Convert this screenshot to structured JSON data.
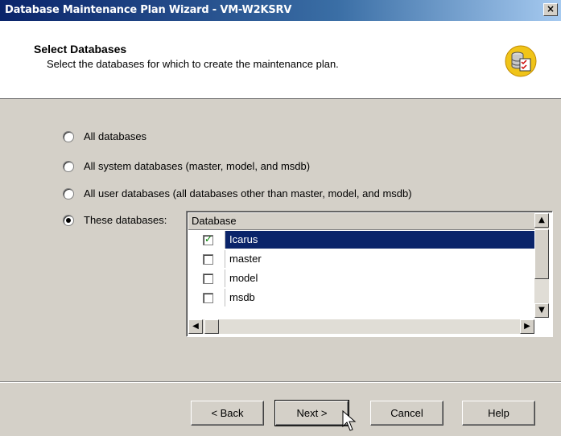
{
  "window": {
    "title": "Database Maintenance Plan Wizard - VM-W2KSRV",
    "close_label": "×"
  },
  "header": {
    "title": "Select Databases",
    "subtitle": "Select the databases for which to create the maintenance plan.",
    "icon": "database-checklist-icon"
  },
  "options": [
    {
      "label": "All databases",
      "checked": false
    },
    {
      "label": "All system databases (master, model, and msdb)",
      "checked": false
    },
    {
      "label": "All user databases (all databases other than master, model, and msdb)",
      "checked": false
    },
    {
      "label": "These databases:",
      "checked": true
    }
  ],
  "database_list": {
    "column_header": "Database",
    "rows": [
      {
        "name": "Icarus",
        "checked": true,
        "selected": true
      },
      {
        "name": "master",
        "checked": false,
        "selected": false
      },
      {
        "name": "model",
        "checked": false,
        "selected": false
      },
      {
        "name": "msdb",
        "checked": false,
        "selected": false
      }
    ]
  },
  "buttons": {
    "back": "< Back",
    "next": "Next >",
    "cancel": "Cancel",
    "help": "Help"
  },
  "colors": {
    "titlebar": "#0a246a",
    "selection": "#0a246a",
    "face": "#d4d0c8",
    "check": "#008000"
  }
}
